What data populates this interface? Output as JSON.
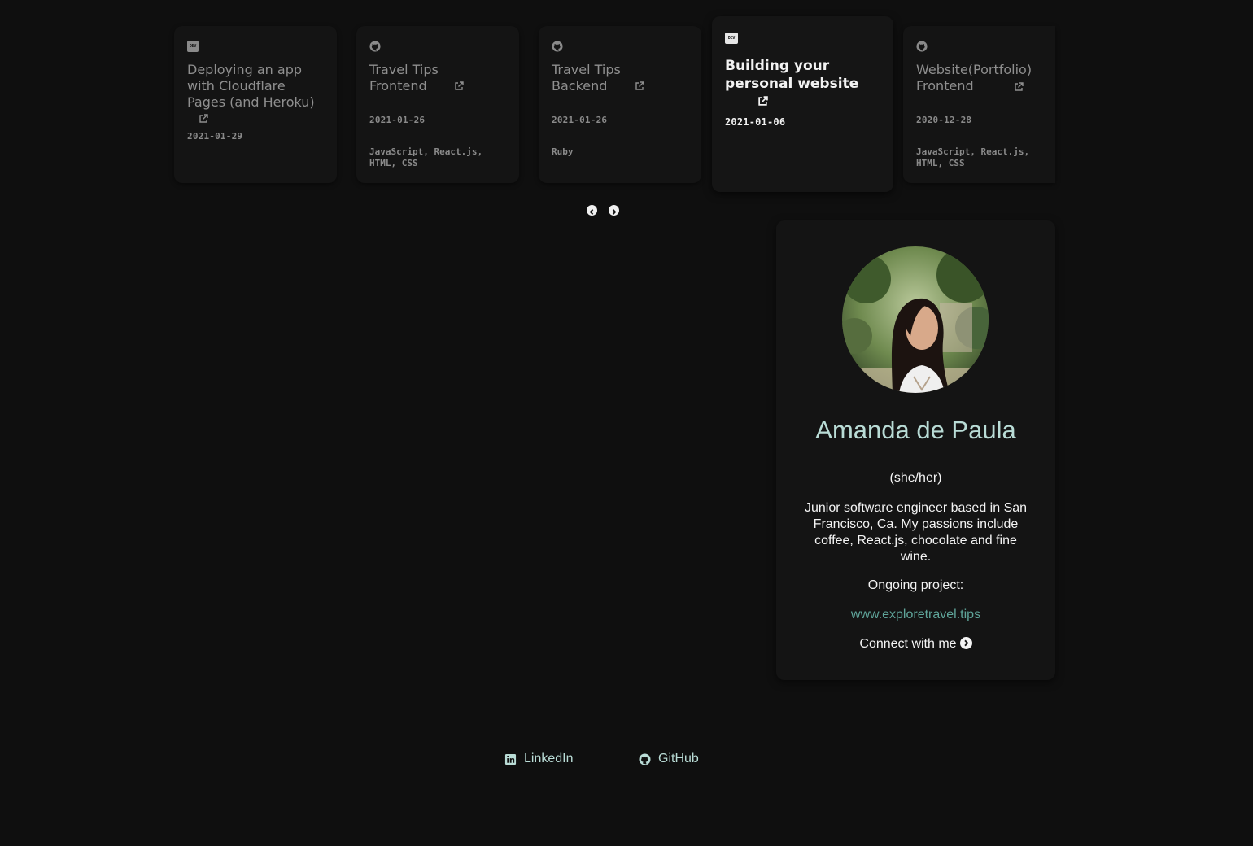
{
  "carousel": {
    "cards": [
      {
        "source_icon": "dev-icon",
        "title": "Deploying an app with Cloudflare Pages (and Heroku)",
        "date": "2021-01-29",
        "tags": ""
      },
      {
        "source_icon": "github-icon",
        "title": "Travel Tips Frontend",
        "date": "2021-01-26",
        "tags": "JavaScript, React.js, HTML, CSS"
      },
      {
        "source_icon": "github-icon",
        "title": "Travel Tips Backend",
        "date": "2021-01-26",
        "tags": "Ruby"
      },
      {
        "source_icon": "dev-icon",
        "title": "Building your personal website",
        "date": "2021-01-06",
        "tags": "",
        "active": true
      },
      {
        "source_icon": "github-icon",
        "title": "Website(Portfolio) Frontend",
        "date": "2020-12-28",
        "tags": "JavaScript, React.js, HTML, CSS"
      }
    ],
    "dev_badge_text": "DEV",
    "prev_label": "previous",
    "next_label": "next"
  },
  "profile": {
    "name": "Amanda de Paula",
    "pronouns": "(she/her)",
    "bio": "Junior software engineer based in San Francisco, Ca. My passions include coffee, React.js, chocolate and fine wine.",
    "ongoing_label": "Ongoing project:",
    "project_link": "www.exploretravel.tips",
    "connect_label": "Connect with me"
  },
  "footer": {
    "linkedin_label": "LinkedIn",
    "github_label": "GitHub"
  },
  "colors": {
    "background": "#0f0f0f",
    "card": "#141414",
    "accent_mint": "#b9dcd6",
    "link_teal": "#5fa59a"
  }
}
